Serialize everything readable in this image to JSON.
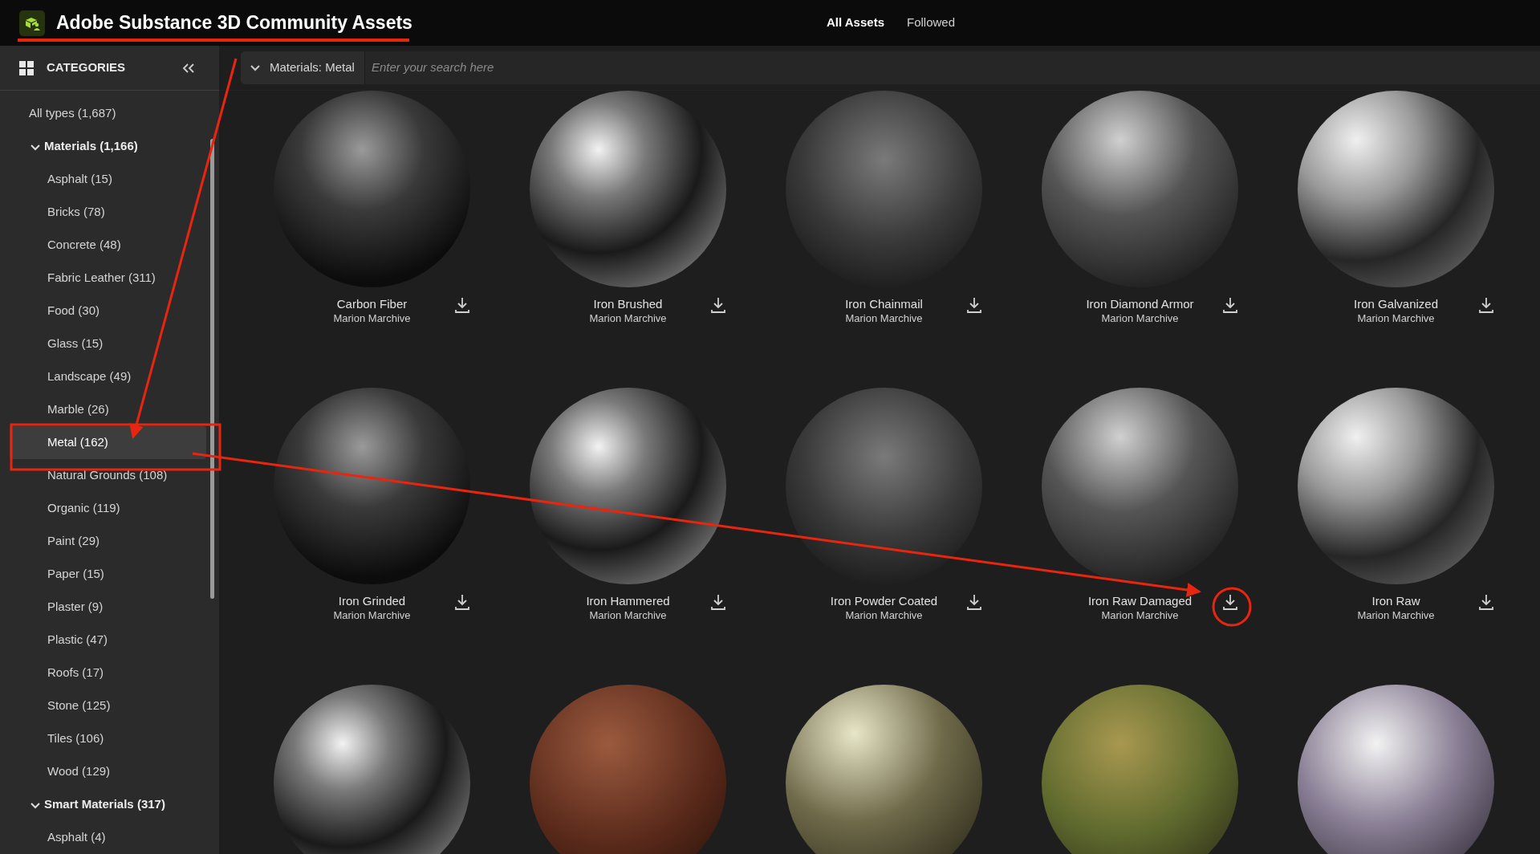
{
  "app": {
    "title": "Adobe Substance 3D Community Assets"
  },
  "nav": [
    {
      "label": "All Assets",
      "selected": true
    },
    {
      "label": "Followed",
      "selected": false
    }
  ],
  "sidebar": {
    "title": "CATEGORIES",
    "items": [
      {
        "label": "All types (1,687)",
        "selected": false
      },
      {
        "label": "Materials (1,166)",
        "selected": false,
        "expanded": true,
        "children": [
          {
            "label": "Asphalt (15)",
            "selected": false
          },
          {
            "label": "Bricks (78)",
            "selected": false
          },
          {
            "label": "Concrete (48)",
            "selected": false
          },
          {
            "label": "Fabric Leather (311)",
            "selected": false
          },
          {
            "label": "Food (30)",
            "selected": false
          },
          {
            "label": "Glass (15)",
            "selected": false
          },
          {
            "label": "Landscape (49)",
            "selected": false
          },
          {
            "label": "Marble (26)",
            "selected": false
          },
          {
            "label": "Metal (162)",
            "selected": true
          },
          {
            "label": "Natural Grounds (108)",
            "selected": false
          },
          {
            "label": "Organic (119)",
            "selected": false
          },
          {
            "label": "Paint (29)",
            "selected": false
          },
          {
            "label": "Paper (15)",
            "selected": false
          },
          {
            "label": "Plaster (9)",
            "selected": false
          },
          {
            "label": "Plastic (47)",
            "selected": false
          },
          {
            "label": "Roofs (17)",
            "selected": false
          },
          {
            "label": "Stone (125)",
            "selected": false
          },
          {
            "label": "Tiles (106)",
            "selected": false
          },
          {
            "label": "Wood (129)",
            "selected": false
          }
        ]
      },
      {
        "label": "Smart Materials (317)",
        "selected": false,
        "expanded": true,
        "children": [
          {
            "label": "Asphalt (4)",
            "selected": false
          }
        ]
      }
    ]
  },
  "filter": {
    "label": "Materials: Metal"
  },
  "search": {
    "placeholder": "Enter your search here"
  },
  "assets": [
    {
      "name": "Carbon Fiber",
      "author": "Marion Marchive"
    },
    {
      "name": "Iron Brushed",
      "author": "Marion Marchive"
    },
    {
      "name": "Iron Chainmail",
      "author": "Marion Marchive"
    },
    {
      "name": "Iron Diamond Armor",
      "author": "Marion Marchive"
    },
    {
      "name": "Iron Galvanized",
      "author": "Marion Marchive"
    },
    {
      "name": "Iron Grinded",
      "author": "Marion Marchive"
    },
    {
      "name": "Iron Hammered",
      "author": "Marion Marchive"
    },
    {
      "name": "Iron Powder Coated",
      "author": "Marion Marchive"
    },
    {
      "name": "Iron Raw Damaged",
      "author": "Marion Marchive"
    },
    {
      "name": "Iron Raw",
      "author": "Marion Marchive"
    }
  ]
}
